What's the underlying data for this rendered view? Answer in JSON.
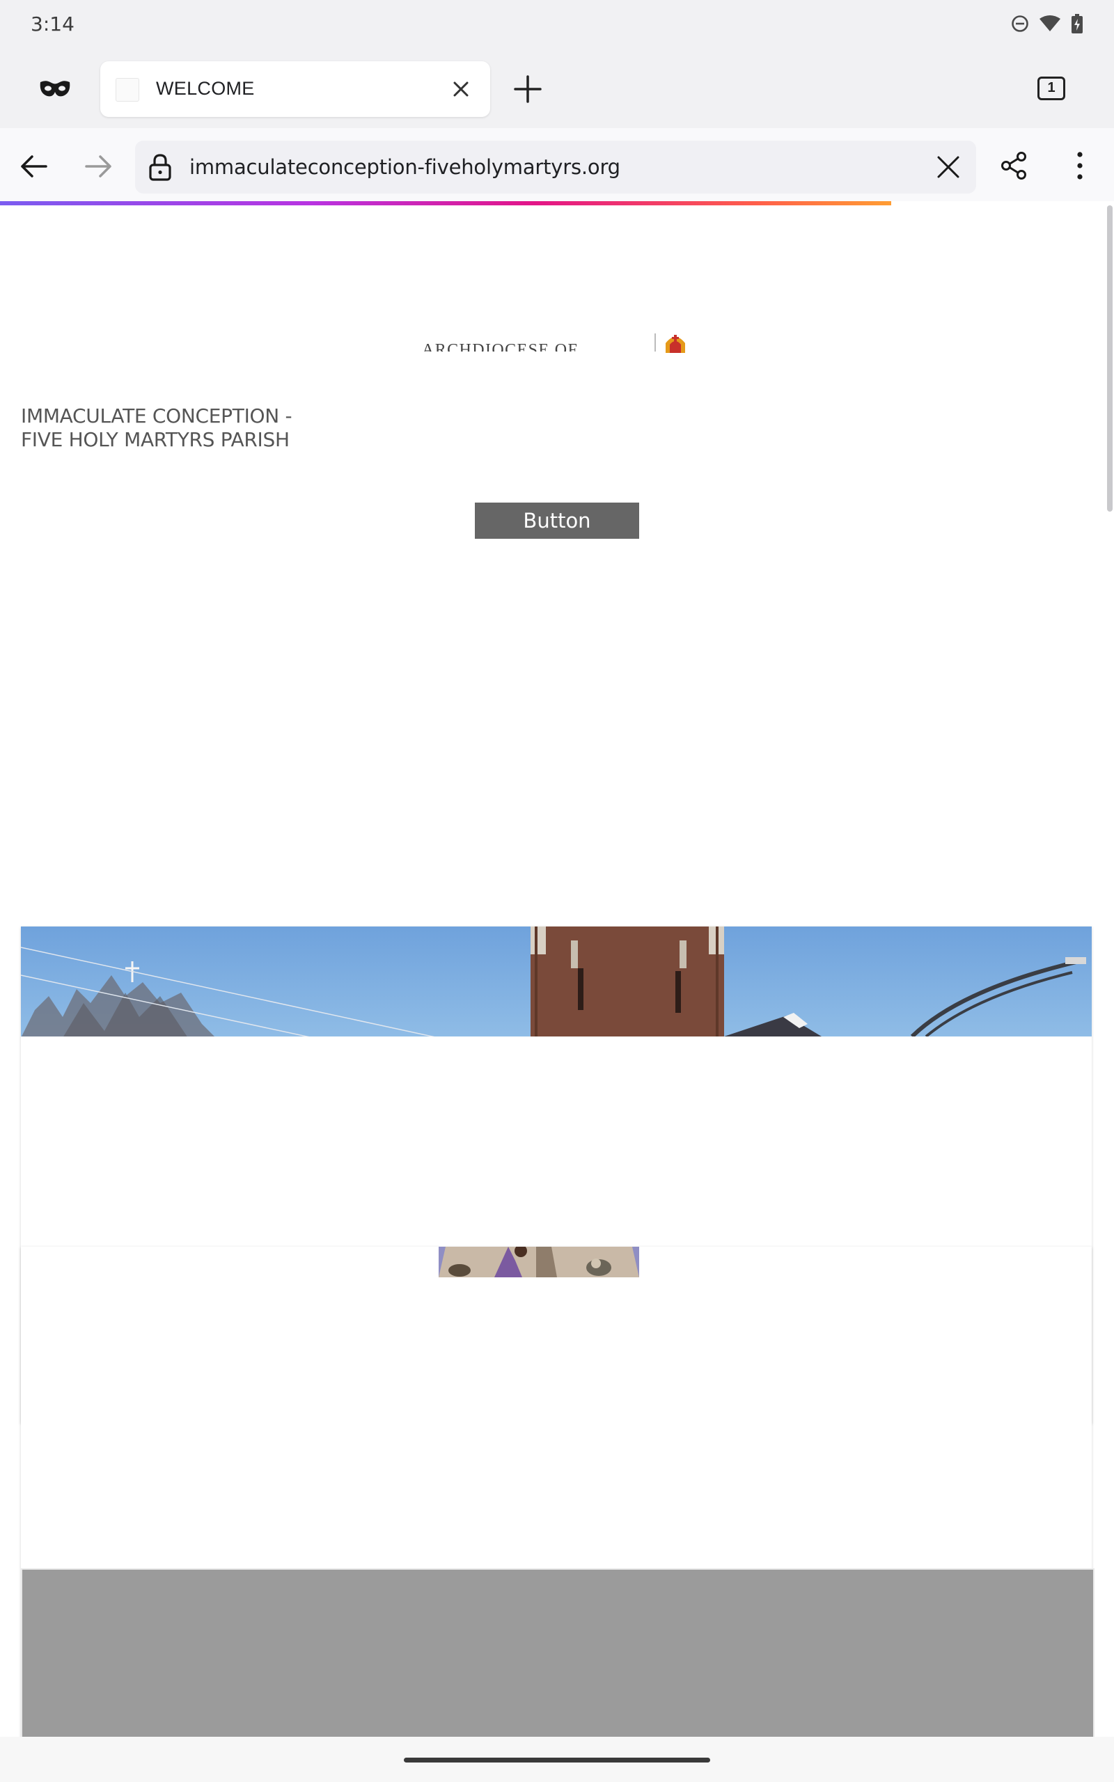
{
  "status_bar": {
    "time": "3:14",
    "icons": [
      "do-not-disturb-icon",
      "wifi-icon",
      "battery-charging-icon"
    ]
  },
  "tabs": {
    "private_mode_icon": "private-mask-icon",
    "active_tab": {
      "title": "WELCOME",
      "close_icon": "close-icon"
    },
    "new_tab_icon": "plus-icon",
    "tab_count": "1"
  },
  "toolbar": {
    "back_icon": "arrow-left-icon",
    "forward_icon": "arrow-right-icon",
    "url": "immaculateconception-fiveholymartyrs.org",
    "lock_icon": "lock-icon",
    "clear_icon": "close-icon",
    "share_icon": "share-icon",
    "menu_icon": "more-vertical-icon",
    "page_load_progress": 0.8
  },
  "page": {
    "archdiocese_text": "ARCHDIOCESE OF CHICAGO",
    "parish_name": "IMMACULATE CONCEPTION - FIVE HOLY MARTYRS PARISH",
    "button_label": "Button"
  },
  "colors": {
    "browser_chrome": "#f1f1f3",
    "button_bg": "#666666",
    "placeholder_gray": "#9b9b9b"
  }
}
